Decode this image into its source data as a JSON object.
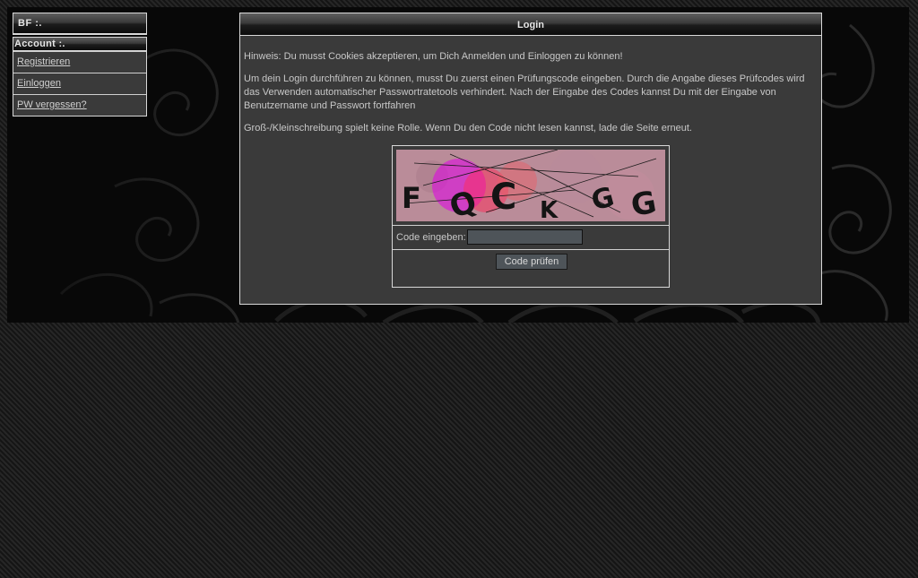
{
  "sidebar": {
    "site_title": "BF :.",
    "account_header": "Account :.",
    "items": [
      {
        "label": "Registrieren"
      },
      {
        "label": "Einloggen"
      },
      {
        "label": "PW vergessen?"
      }
    ]
  },
  "login": {
    "title": "Login",
    "paragraphs": [
      "Hinweis: Du musst Cookies akzeptieren, um Dich Anmelden und Einloggen zu können!",
      "Um dein Login durchführen zu können, musst Du zuerst einen Prüfungscode eingeben. Durch die Angabe dieses Prüfcodes wird das Verwenden automatischer Passwortratetools verhindert. Nach der Eingabe des Codes kannst Du mit der Eingabe von Benutzername und Passwort fortfahren",
      "Groß-/Kleinschreibung spielt keine Rolle. Wenn Du den Code nicht lesen kannst, lade die Seite erneut."
    ],
    "captcha": {
      "characters": [
        "F",
        "Q",
        "C",
        "K",
        "G",
        "G"
      ],
      "input_label": "Code eingeben:",
      "input_value": "",
      "submit_label": "Code prüfen"
    }
  },
  "colors": {
    "page_background": "#1b1b1b",
    "panel_background": "#3a3a3a",
    "border": "#d8d8d8",
    "text": "#c8c8c8",
    "input_background": "#4e5459",
    "captcha_background": "#c47e93",
    "captcha_accent": "#e000e8"
  }
}
